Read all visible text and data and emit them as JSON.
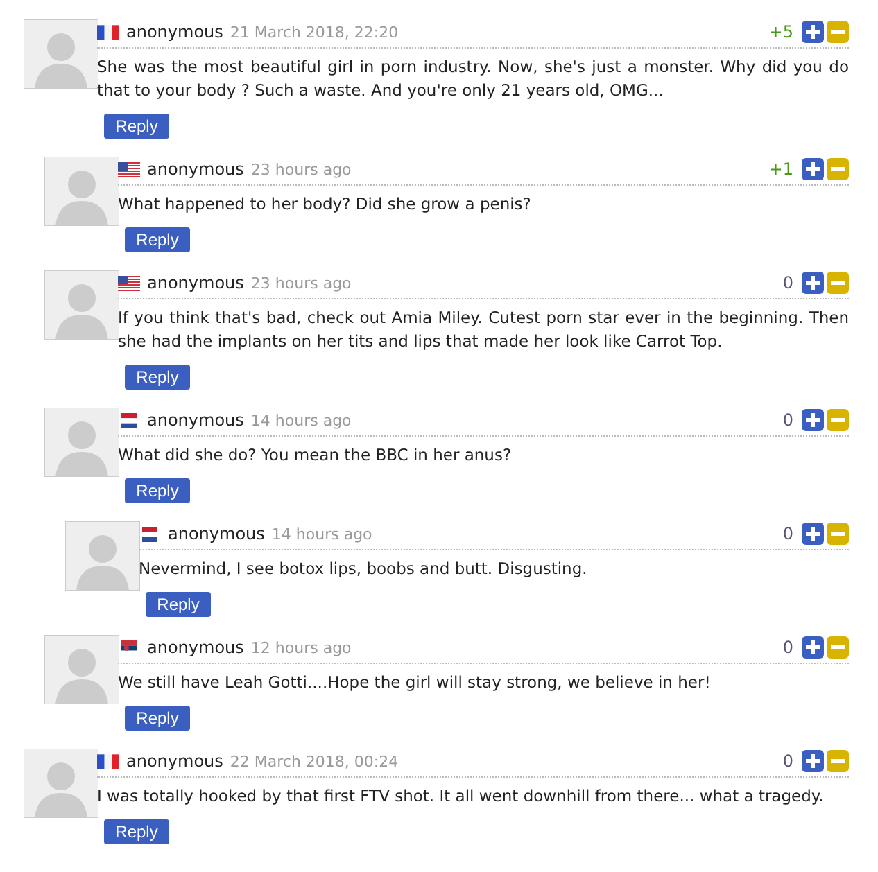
{
  "comments": [
    {
      "kind": "fr",
      "author": "anonymous",
      "time": "21 March 2018, 22:20",
      "score": "+5",
      "color": "#4a9a1a",
      "text": "She was the most beautiful girl in porn industry. Now, she's just a monster. Why did you do that to your body ? Such a waste. And you're only 21 years old, OMG...",
      "reply": "Reply",
      "children": [
        {
          "kind": "us",
          "author": "anonymous",
          "time": "23 hours ago",
          "score": "+1",
          "color": "#4a9a1a",
          "text": "What happened to her body?  Did she grow a penis?",
          "reply": "Reply"
        },
        {
          "kind": "us",
          "author": "anonymous",
          "time": "23 hours ago",
          "score": "0",
          "color": "#555577",
          "text": "If you think that's bad, check out Amia Miley.  Cutest porn star ever in the beginning.  Then she had the implants on her tits and lips that made her look like Carrot Top.",
          "reply": "Reply"
        },
        {
          "kind": "nl",
          "author": "anonymous",
          "time": "14 hours ago",
          "score": "0",
          "color": "#555577",
          "text": "What did she do? You mean the BBC in her anus?",
          "reply": "Reply",
          "children": [
            {
              "kind": "nl",
              "author": "anonymous",
              "time": "14 hours ago",
              "score": "0",
              "color": "#555577",
              "text": "Nevermind, I see botox lips, boobs and butt. Disgusting.",
              "reply": "Reply"
            }
          ]
        },
        {
          "kind": "rs",
          "author": "anonymous",
          "time": "12 hours ago",
          "score": "0",
          "color": "#555577",
          "text": "We still have Leah Gotti....Hope the girl will stay strong, we believe in her!",
          "reply": "Reply"
        }
      ]
    },
    {
      "kind": "fr",
      "author": "anonymous",
      "time": "22 March 2018, 00:24",
      "score": "0",
      "color": "#555577",
      "text": "I was totally hooked by that first FTV shot. It all went downhill from there... what a tragedy.",
      "reply": "Reply"
    }
  ]
}
